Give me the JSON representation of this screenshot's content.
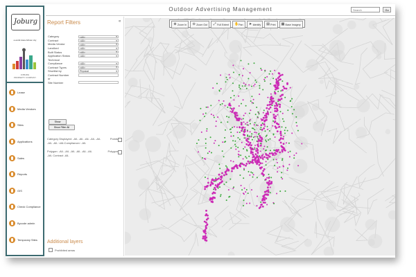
{
  "app": {
    "title": "Outdoor Advertising Management",
    "search_placeholder": "Search",
    "go_label": "Go"
  },
  "brand": {
    "logo_text": "Joburg",
    "tagline": "a world class African city",
    "caption_line1": "JOBURG",
    "caption_line2": "PROPERTY COMPANY"
  },
  "nav": [
    {
      "label": "Lease",
      "icon": "lease-icon"
    },
    {
      "label": "Media Vendors",
      "icon": "vendors-icon"
    },
    {
      "label": "Sites",
      "icon": "sites-icon"
    },
    {
      "label": "Applications",
      "icon": "applications-icon"
    },
    {
      "label": "Sales",
      "icon": "sales-icon"
    },
    {
      "label": "Reports",
      "icon": "reports-icon"
    },
    {
      "label": "GIS",
      "icon": "gis-icon"
    },
    {
      "label": "Check Compliance",
      "icon": "compliance-icon"
    },
    {
      "label": "Bycode admin",
      "icon": "admin-icon"
    },
    {
      "label": "Temporary Sites",
      "icon": "temp-sites-icon"
    }
  ],
  "filters": {
    "title": "Report Filters",
    "collapse_icon": "«",
    "rows": [
      {
        "label": "Category",
        "value": "<All>"
      },
      {
        "label": "Contract",
        "value": "<All>"
      },
      {
        "label": "Media Vendor",
        "value": "<All>"
      },
      {
        "label": "Landlord",
        "value": "<All>"
      },
      {
        "label": "Built Status",
        "value": "<All>"
      },
      {
        "label": "Application Status",
        "value": "<All>"
      }
    ],
    "rows2": [
      {
        "label": "Compliance",
        "value": "<All>"
      },
      {
        "label": "Contract Types",
        "value": "<All>"
      },
      {
        "label": "Shortlist by",
        "value": "Physical"
      }
    ],
    "technical_label": "Technical",
    "contract_number_label": "Contract Number",
    "or_label": "or",
    "site_number_label": "Site Number",
    "show_label": "Show",
    "show_all_label": "Show Filter All",
    "legend_line1": "Category Displayed: -All- -All- -All- -All- -All-",
    "legend_line2": "-All- -All- <All-Compliance> -All-",
    "legend_line3": "Polygon: -All- -All- -All- -All- -All- -All-",
    "legend_line4": "-All- Contract -All-",
    "legend_tag1": "Points",
    "legend_tag2": "Polygon"
  },
  "layers": {
    "title": "Additional layers",
    "item_label": "Prohibited areas"
  },
  "toolbar": [
    {
      "label": "Zoom In",
      "icon": "⊕"
    },
    {
      "label": "Zoom Out",
      "icon": "⊖"
    },
    {
      "label": "Full Extent",
      "icon": "⤢"
    },
    {
      "label": "Pan",
      "icon": "✋"
    },
    {
      "label": "Identify",
      "icon": "➤"
    },
    {
      "label": "Print",
      "icon": "▤"
    },
    {
      "label": "Base Imagery",
      "icon": "▦"
    }
  ],
  "colors": {
    "accent": "#c98a4a",
    "nav_border": "#3c6a70",
    "nav_icon": "#d98a2b",
    "points_magenta": "#cc2bb6",
    "points_green": "#3aa83a"
  }
}
